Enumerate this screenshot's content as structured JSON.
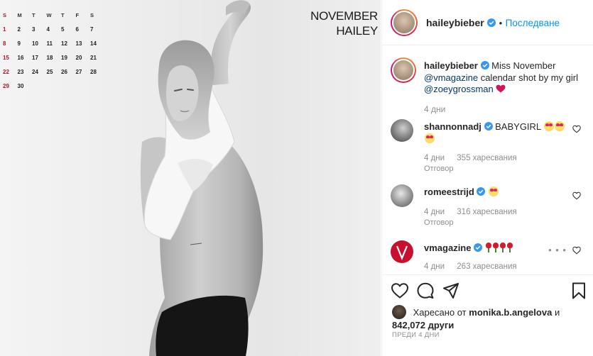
{
  "calendar": {
    "weekdays": [
      "S",
      "M",
      "T",
      "W",
      "T",
      "F",
      "S"
    ],
    "weeks": [
      [
        "1",
        "2",
        "3",
        "4",
        "5",
        "6",
        "7"
      ],
      [
        "8",
        "9",
        "10",
        "11",
        "12",
        "13",
        "14"
      ],
      [
        "15",
        "16",
        "17",
        "18",
        "19",
        "20",
        "21"
      ],
      [
        "22",
        "23",
        "24",
        "25",
        "26",
        "27",
        "28"
      ],
      [
        "29",
        "30",
        "",
        "",
        "",
        "",
        ""
      ]
    ],
    "month": "NOVEMBER",
    "name": "HAILEY"
  },
  "header": {
    "username": "haileybieber",
    "separator": "•",
    "follow_label": "Последване"
  },
  "caption": {
    "username": "haileybieber",
    "text_1": "Miss November",
    "mention_1": "@vmagazine",
    "text_2": "calendar shot by my girl",
    "mention_2": "@zoeygrossman",
    "time": "4 дни"
  },
  "comments": [
    {
      "username": "shannonnadj",
      "text": "BABYGIRL",
      "time": "4 дни",
      "likes": "355 харесвания",
      "reply": "Отговор"
    },
    {
      "username": "romeestrijd",
      "text": "",
      "time": "4 дни",
      "likes": "316 харесвания",
      "reply": "Отговор"
    },
    {
      "username": "vmagazine",
      "text": "",
      "time": "4 дни",
      "likes": "263 харесвания",
      "more": "• • •"
    }
  ],
  "likes": {
    "prefix": "Харесано от",
    "user": "monika.b.angelova",
    "conj": "и",
    "count": "842,072",
    "suffix": "други"
  },
  "posted_ago": "ПРЕДИ 4 ДНИ",
  "colors": {
    "accent_blue": "#0095f6",
    "mention": "#00376b",
    "muted": "#8e8e8e",
    "heart_red": "#ed4956"
  },
  "icons": [
    "verified-badge-icon",
    "heart-icon",
    "comment-icon",
    "share-icon",
    "bookmark-icon",
    "more-icon"
  ]
}
